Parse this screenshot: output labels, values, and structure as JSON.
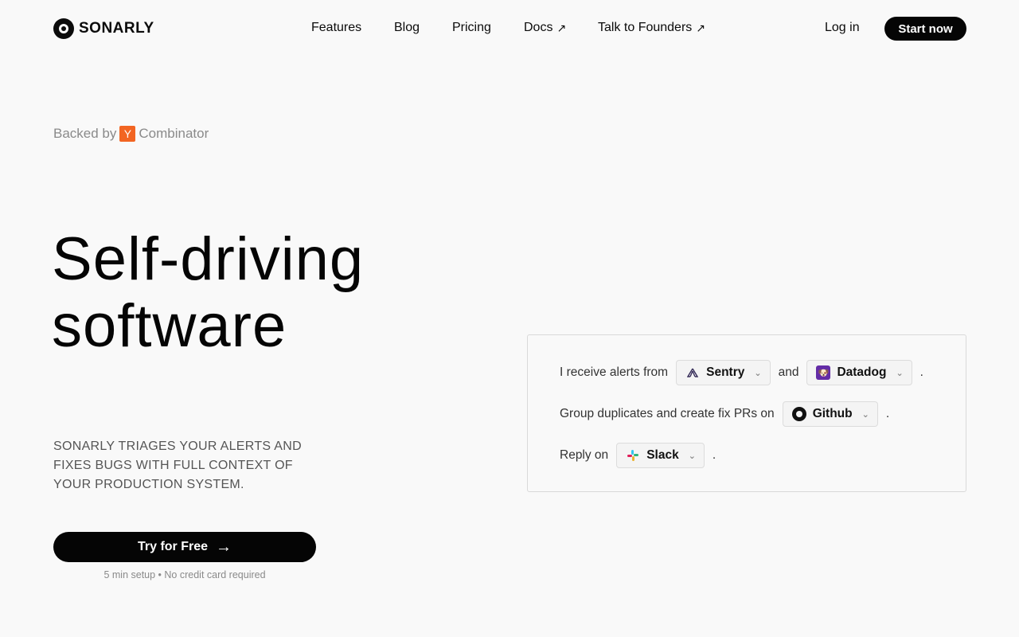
{
  "header": {
    "brand": "SONARLY",
    "nav": [
      {
        "label": "Features"
      },
      {
        "label": "Blog"
      },
      {
        "label": "Pricing"
      },
      {
        "label": "Docs",
        "external": "↗"
      },
      {
        "label": "Talk to Founders",
        "external": "↗"
      }
    ],
    "login": "Log in",
    "start": "Start now"
  },
  "hero": {
    "backed_prefix": "Backed by",
    "yc_letter": "Y",
    "backed_suffix": "Combinator",
    "title_line1": "Self-driving",
    "title_line2": "software",
    "tagline": "SONARLY TRIAGES YOUR ALERTS AND FIXES BUGS WITH FULL CONTEXT OF YOUR PRODUCTION SYSTEM.",
    "cta": "Try for Free",
    "cta_note": "5 min setup • No credit card required"
  },
  "config": {
    "row1_prefix": "I receive alerts from",
    "row1_sel1": "Sentry",
    "row1_and": "and",
    "row1_sel2": "Datadog",
    "row2_prefix": "Group duplicates and create fix PRs on",
    "row2_sel": "Github",
    "row3_prefix": "Reply on",
    "row3_sel": "Slack",
    "period": "."
  },
  "colors": {
    "accent": "#050505",
    "yc_orange": "#f26522",
    "datadog_purple": "#632ca6"
  }
}
